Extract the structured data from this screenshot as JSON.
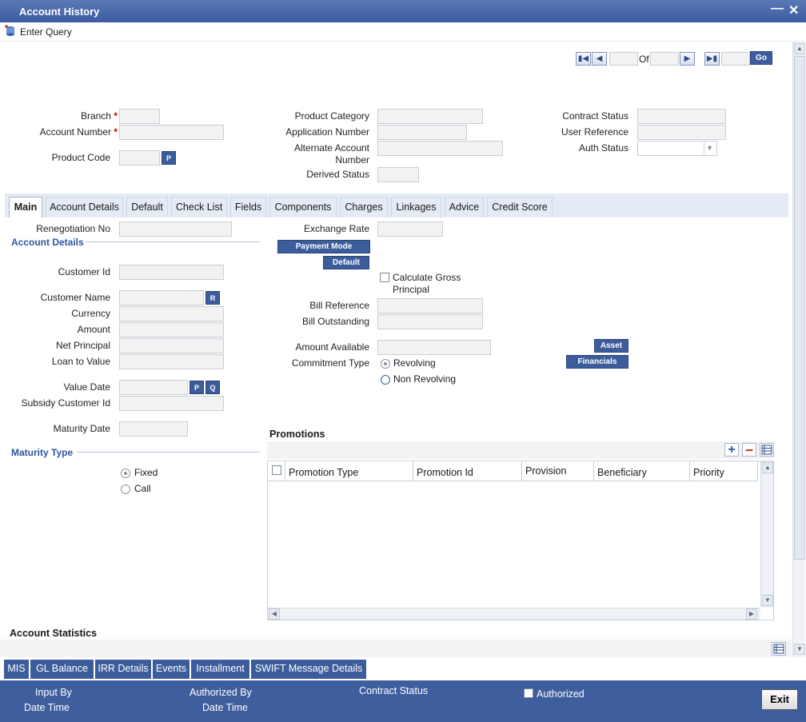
{
  "window": {
    "title": "Account History"
  },
  "menubar": {
    "enter_query": "Enter Query"
  },
  "navigation": {
    "of_label": "Of",
    "go_label": "Go"
  },
  "header": {
    "branch_label": "Branch",
    "account_number_label": "Account Number",
    "product_code_label": "Product Code",
    "product_code_btn": "P",
    "product_category_label": "Product Category",
    "application_number_label": "Application Number",
    "alternate_account_number_label": "Alternate Account Number",
    "derived_status_label": "Derived Status",
    "contract_status_label": "Contract Status",
    "user_reference_label": "User Reference",
    "auth_status_label": "Auth Status",
    "required_mark": "*"
  },
  "tabs": [
    "Main",
    "Account Details",
    "Default",
    "Check List",
    "Fields",
    "Components",
    "Charges",
    "Linkages",
    "Advice",
    "Credit Score"
  ],
  "main": {
    "renegotiation_no_label": "Renegotiation No",
    "account_details_header": "Account Details",
    "customer_id_label": "Customer Id",
    "customer_name_label": "Customer Name",
    "customer_name_btn": "R",
    "currency_label": "Currency",
    "amount_label": "Amount",
    "net_principal_label": "Net Principal",
    "loan_to_value_label": "Loan to Value",
    "value_date_label": "Value Date",
    "value_date_btn_p": "P",
    "value_date_btn_q": "Q",
    "subsidy_customer_id_label": "Subsidy Customer Id",
    "maturity_date_label": "Maturity Date",
    "maturity_type_header": "Maturity Type",
    "maturity_fixed": "Fixed",
    "maturity_call": "Call",
    "exchange_rate_label": "Exchange Rate",
    "payment_mode_btn": "Payment Mode",
    "default_btn": "Default",
    "calculate_gross_principal": "Calculate Gross Principal",
    "bill_reference_label": "Bill Reference",
    "bill_outstanding_label": "Bill Outstanding",
    "amount_available_label": "Amount Available",
    "commitment_type_label": "Commitment Type",
    "revolving": "Revolving",
    "non_revolving": "Non Revolving",
    "asset_btn": "Asset",
    "financials_btn": "Financials"
  },
  "promotions": {
    "title": "Promotions",
    "columns": [
      "Promotion Type",
      "Promotion Id",
      "Provision",
      "Beneficiary",
      "Priority"
    ]
  },
  "account_statistics": {
    "title": "Account Statistics"
  },
  "bottom_tabs": [
    "MIS",
    "GL Balance",
    "IRR Details",
    "Events",
    "Installment",
    "SWIFT Message Details"
  ],
  "footer": {
    "input_by": "Input By",
    "date_time_1": "Date Time",
    "authorized_by": "Authorized By",
    "date_time_2": "Date Time",
    "contract_status": "Contract Status",
    "authorized": "Authorized",
    "exit": "Exit"
  },
  "colors": {
    "primary": "#3c5d9c",
    "title_bar": "#4a69ad",
    "section_header": "#2c56a0",
    "required": "#cc0000"
  }
}
